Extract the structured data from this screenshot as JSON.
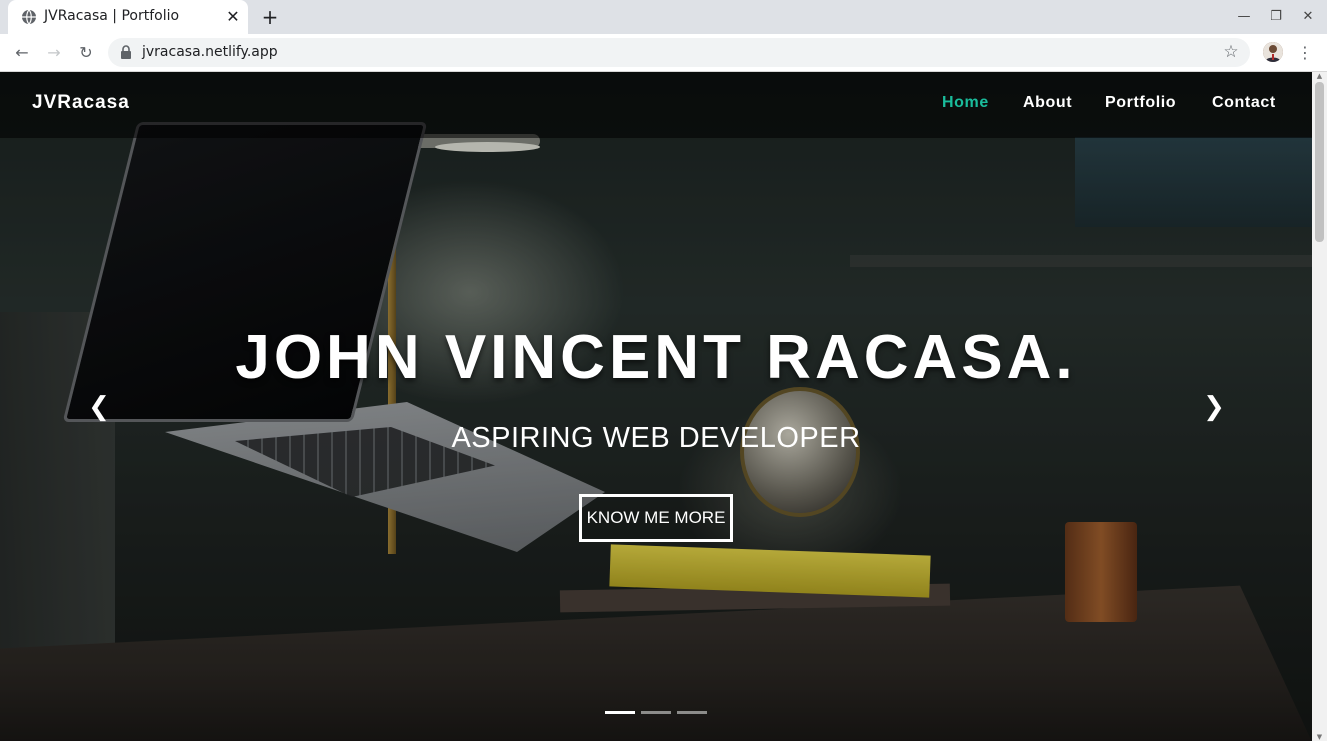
{
  "browser": {
    "tab_title": "JVRacasa | Portfolio",
    "tab_close": "✕",
    "new_tab": "+",
    "url": "jvracasa.netlify.app",
    "back": "←",
    "forward": "→",
    "reload": "↻",
    "star": "☆",
    "menu": "⋮",
    "minimize": "—",
    "restore": "❐",
    "close": "✕",
    "icons": {
      "favicon": "globe-icon",
      "lock": "lock-icon",
      "star": "star-icon",
      "avatar": "profile-avatar"
    }
  },
  "site": {
    "brand": "JVRacasa",
    "nav": [
      {
        "label": "Home",
        "active": true
      },
      {
        "label": "About",
        "active": false
      },
      {
        "label": "Portfolio",
        "active": false
      },
      {
        "label": "Contact",
        "active": false
      }
    ],
    "hero": {
      "title": "JOHN VINCENT RACASA.",
      "subtitle": "ASPIRING WEB DEVELOPER",
      "button": "KNOW ME MORE"
    },
    "carousel": {
      "prev_glyph": "❮",
      "next_glyph": "❯",
      "slide_count": 3,
      "active_slide": 1
    },
    "colors": {
      "accent": "#1abc9c",
      "nav_text": "#ffffff"
    }
  }
}
